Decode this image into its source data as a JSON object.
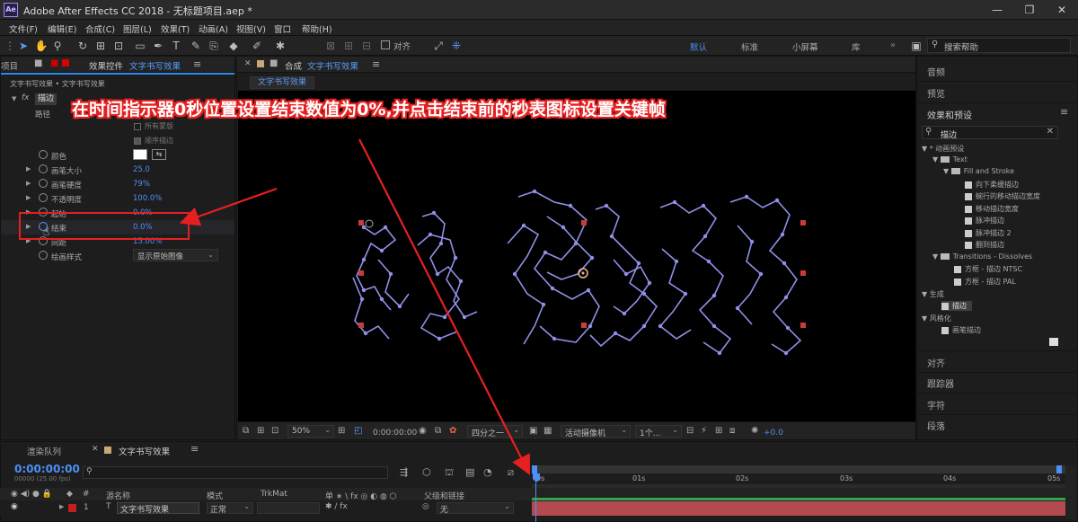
{
  "window": {
    "title": "Adobe After Effects CC 2018 - 无标题项目.aep *",
    "app_icon": "Ae"
  },
  "menu": [
    "文件(F)",
    "编辑(E)",
    "合成(C)",
    "图层(L)",
    "效果(T)",
    "动画(A)",
    "视图(V)",
    "窗口",
    "帮助(H)"
  ],
  "toolbar": {
    "align_label": "对齐",
    "workspaces": [
      "默认",
      "标准",
      "小屏幕",
      "库"
    ],
    "search_placeholder": "搜索帮助"
  },
  "effects_panel": {
    "tab_left": "项目",
    "tab_label": "效果控件",
    "comp_name": "文字书写效果",
    "breadcrumb": "文字书写效果 • 文字书写效果",
    "effect_name": "描边",
    "path_label": "路径",
    "all_masks": "所有蒙版",
    "sequential": "顺序描边",
    "props": [
      {
        "name": "颜色",
        "value": ""
      },
      {
        "name": "画笔大小",
        "value": "25.0"
      },
      {
        "name": "画笔硬度",
        "value": "79%"
      },
      {
        "name": "不透明度",
        "value": "100.0%"
      },
      {
        "name": "起始",
        "value": "0.0%"
      },
      {
        "name": "结束",
        "value": "0.0%"
      },
      {
        "name": "间距",
        "value": "15.00%"
      },
      {
        "name": "绘画样式",
        "value": "显示原始图像"
      }
    ]
  },
  "comp_panel": {
    "tab_label": "合成",
    "comp_name": "文字书写效果",
    "subtab": "文字书写效果"
  },
  "annotation": "在时间指示器0秒位置设置结束数值为0%,并点击结束前的秒表图标设置关键帧",
  "viewer_bar": {
    "zoom": "50%",
    "time": "0:00:00:00",
    "resolution": "四分之一",
    "camera": "活动摄像机",
    "views": "1个...",
    "exposure": "+0.0"
  },
  "right_panel": {
    "items_top": [
      "音频",
      "预览",
      "效果和预设"
    ],
    "search_value": "描边",
    "tree": [
      {
        "label": "* 动画预设",
        "indent": 0,
        "type": "arrow"
      },
      {
        "label": "Text",
        "indent": 1,
        "type": "folder"
      },
      {
        "label": "Fill and Stroke",
        "indent": 2,
        "type": "folder"
      },
      {
        "label": "向下柔缓描边",
        "indent": 3,
        "type": "preset"
      },
      {
        "label": "蜿行的移动描边宽度",
        "indent": 3,
        "type": "preset"
      },
      {
        "label": "移动描边宽度",
        "indent": 3,
        "type": "preset"
      },
      {
        "label": "脉冲描边",
        "indent": 3,
        "type": "preset"
      },
      {
        "label": "脉冲描边 2",
        "indent": 3,
        "type": "preset"
      },
      {
        "label": "翻到描边",
        "indent": 3,
        "type": "preset"
      },
      {
        "label": "Transitions - Dissolves",
        "indent": 1,
        "type": "folder"
      },
      {
        "label": "方框 - 描边 NTSC",
        "indent": 2,
        "type": "preset"
      },
      {
        "label": "方框 - 描边 PAL",
        "indent": 2,
        "type": "preset"
      },
      {
        "label": "生成",
        "indent": 0,
        "type": "arrow"
      },
      {
        "label": "描边",
        "indent": 1,
        "type": "selected"
      },
      {
        "label": "风格化",
        "indent": 0,
        "type": "arrow"
      },
      {
        "label": "画笔描边",
        "indent": 1,
        "type": "preset"
      }
    ],
    "items_bottom": [
      "对齐",
      "跟踪器",
      "字符",
      "段落"
    ]
  },
  "timeline": {
    "tab_render": "渲染队列",
    "tab_comp": "文字书写效果",
    "timecode": "0:00:00:00",
    "fps": "00000 (25.00 fps)",
    "cols": {
      "source": "源名称",
      "mode": "模式",
      "trkmat": "TrkMat",
      "parent": "父级和链接"
    },
    "layer": {
      "num": "1",
      "type": "T",
      "name": "文字书写效果",
      "mode": "正常",
      "parent": "无"
    },
    "ticks": [
      "0s",
      "01s",
      "02s",
      "03s",
      "04s",
      "05s"
    ]
  },
  "colors": {
    "accent": "#2d8ceb",
    "annotation": "#ffffff",
    "red": "#e62020",
    "stroke": "#8f8fe8"
  }
}
